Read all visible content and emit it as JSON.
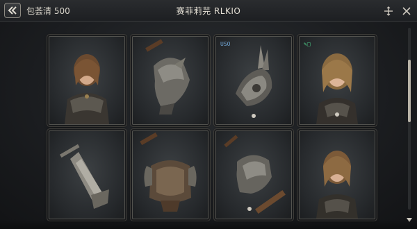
{
  "header": {
    "back_icon": "double-chevron-left-icon",
    "bag_label": "包荟清 500",
    "title": "赛菲莉芫 RLKIO",
    "icons": [
      "move-icon",
      "close-icon"
    ]
  },
  "cards": [
    {
      "type": "portrait",
      "name": "character-portrait",
      "tag": ""
    },
    {
      "type": "helmet",
      "name": "helmet-item",
      "tag": ""
    },
    {
      "type": "spiked-pauldron",
      "name": "spiked-pauldron-item",
      "tag": "USO"
    },
    {
      "type": "portrait",
      "name": "character-portrait",
      "tag": "✎□"
    },
    {
      "type": "sword-blade",
      "name": "blade-item",
      "tag": ""
    },
    {
      "type": "chest-armor",
      "name": "chest-armor-item",
      "tag": ""
    },
    {
      "type": "helmet-handle",
      "name": "armor-piece-item",
      "tag": ""
    },
    {
      "type": "portrait",
      "name": "character-portrait",
      "tag": ""
    }
  ],
  "colors": {
    "accent": "#b9b4a8",
    "card_border": "#52524e",
    "tag_blue": "#6fa3d2",
    "tag_green": "#4fcf8a"
  }
}
